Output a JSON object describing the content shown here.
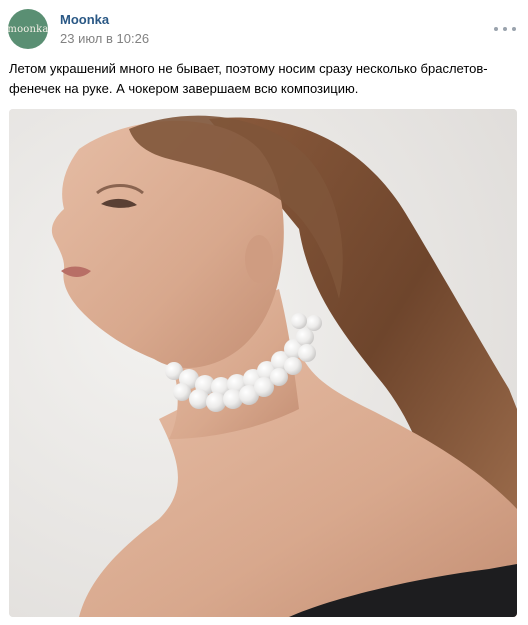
{
  "post": {
    "author": "Moonka",
    "avatar_text": "moonka",
    "date": "23 июл в 10:26",
    "text": "Летом украшений много не бывает, поэтому носим сразу несколько браслетов-фенечек на руке. А чокером завершаем всю композицию.",
    "more_icon": "more-dots-icon",
    "photo": {
      "subject": "woman-wearing-pearl-choker",
      "colors": {
        "background": "#ebe9e7",
        "skin": "#dcb198",
        "hair": "#7a4e34",
        "dress": "#1d1d1f",
        "pearl": "#f2f0ee"
      }
    }
  },
  "theme": {
    "accent": "#2a5885",
    "muted": "#828282",
    "avatar_bg": "#5a8f73"
  }
}
